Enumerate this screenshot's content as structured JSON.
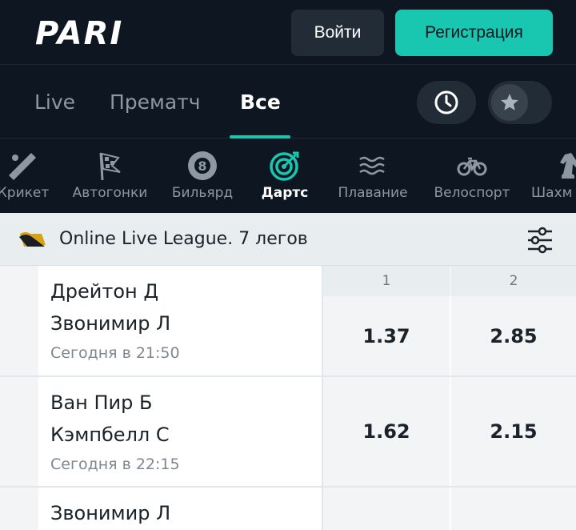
{
  "header": {
    "logo_text": "PARI",
    "login_label": "Войти",
    "register_label": "Регистрация"
  },
  "tabs": [
    {
      "label": "Live",
      "active": false
    },
    {
      "label": "Прематч",
      "active": false
    },
    {
      "label": "Все",
      "active": true
    }
  ],
  "tab_icons": {
    "history": "clock-icon",
    "favorites": "star-icon"
  },
  "sports": [
    {
      "label": "Крикет",
      "icon": "cricket-icon"
    },
    {
      "label": "Автогонки",
      "icon": "racing-flag-icon"
    },
    {
      "label": "Бильярд",
      "icon": "billiard-ball-icon"
    },
    {
      "label": "Дартс",
      "icon": "dartboard-icon",
      "active": true
    },
    {
      "label": "Плавание",
      "icon": "swimming-waves-icon"
    },
    {
      "label": "Велоспорт",
      "icon": "bicycle-icon"
    },
    {
      "label": "Шахм",
      "icon": "chess-knight-icon"
    }
  ],
  "league": {
    "title": "Online Live League. 7 легов",
    "icon": "league-flag-icon"
  },
  "market_header": {
    "col1": "1",
    "col2": "2"
  },
  "matches": [
    {
      "team1": "Дрейтон Д",
      "team2": "Звонимир Л",
      "time": "Сегодня в 21:50",
      "odd1": "1.37",
      "odd2": "2.85"
    },
    {
      "team1": "Ван Пир Б",
      "team2": "Кэмпбелл С",
      "time": "Сегодня в 22:15",
      "odd1": "1.62",
      "odd2": "2.15"
    },
    {
      "team1": "Звонимир Л"
    }
  ],
  "colors": {
    "accent": "#19c7b0",
    "dark_bg": "#0e1621",
    "button_bg": "#222c37"
  }
}
